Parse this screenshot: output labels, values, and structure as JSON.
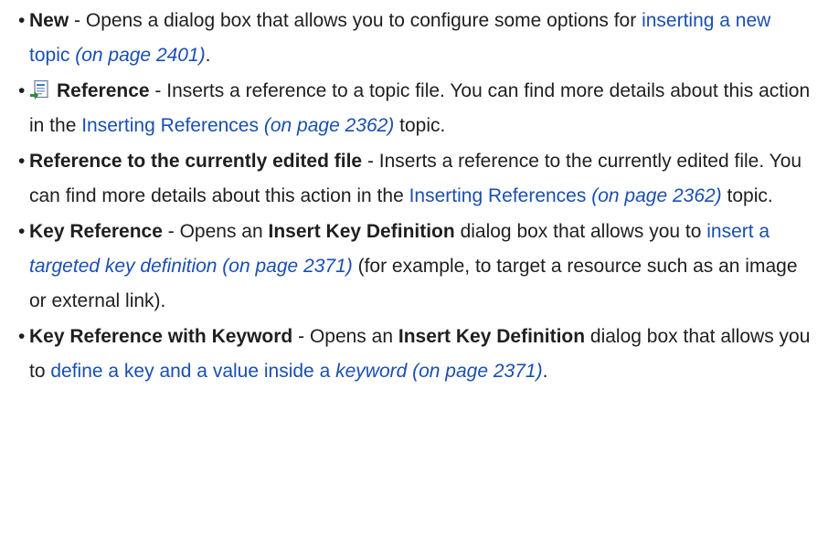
{
  "items": [
    {
      "term": "New",
      "sep": " - ",
      "text1": "Opens a dialog box that allows you to configure some options for",
      "link1": "inserting a new topic",
      "page1": "(on page 2401)",
      "end": "."
    },
    {
      "icon": "reference-icon",
      "term": "Reference",
      "sep": " - ",
      "text1": "Inserts a reference to a topic file. You can find more details about this action in the",
      "link1": "Inserting References",
      "page1": "(on page 2362)",
      "end": " topic."
    },
    {
      "term": "Reference to the currently edited file",
      "sep": " - ",
      "text1": "Inserts a reference to the currently edited file. You can find more details about this action in the",
      "link1": "Inserting References",
      "page1": "(on page 2362)",
      "end": " topic."
    },
    {
      "term": "Key Reference",
      "sep": " - ",
      "text1": "Opens an",
      "bold2": "Insert Key Definition",
      "text2": "dialog box that allows you to",
      "link1a": "insert a",
      "link1b": "targeted key definition (on page 2371)",
      "end": " (for example, to target a resource such as an image or external link)."
    },
    {
      "term": "Key Reference with Keyword",
      "sep": " - ",
      "text1": "Opens an",
      "bold2": "Insert Key Definition",
      "text2": "dialog box that allows you to",
      "link1a": "define a key and a value inside a",
      "link1b": "keyword (on page 2371)",
      "end": "."
    }
  ]
}
